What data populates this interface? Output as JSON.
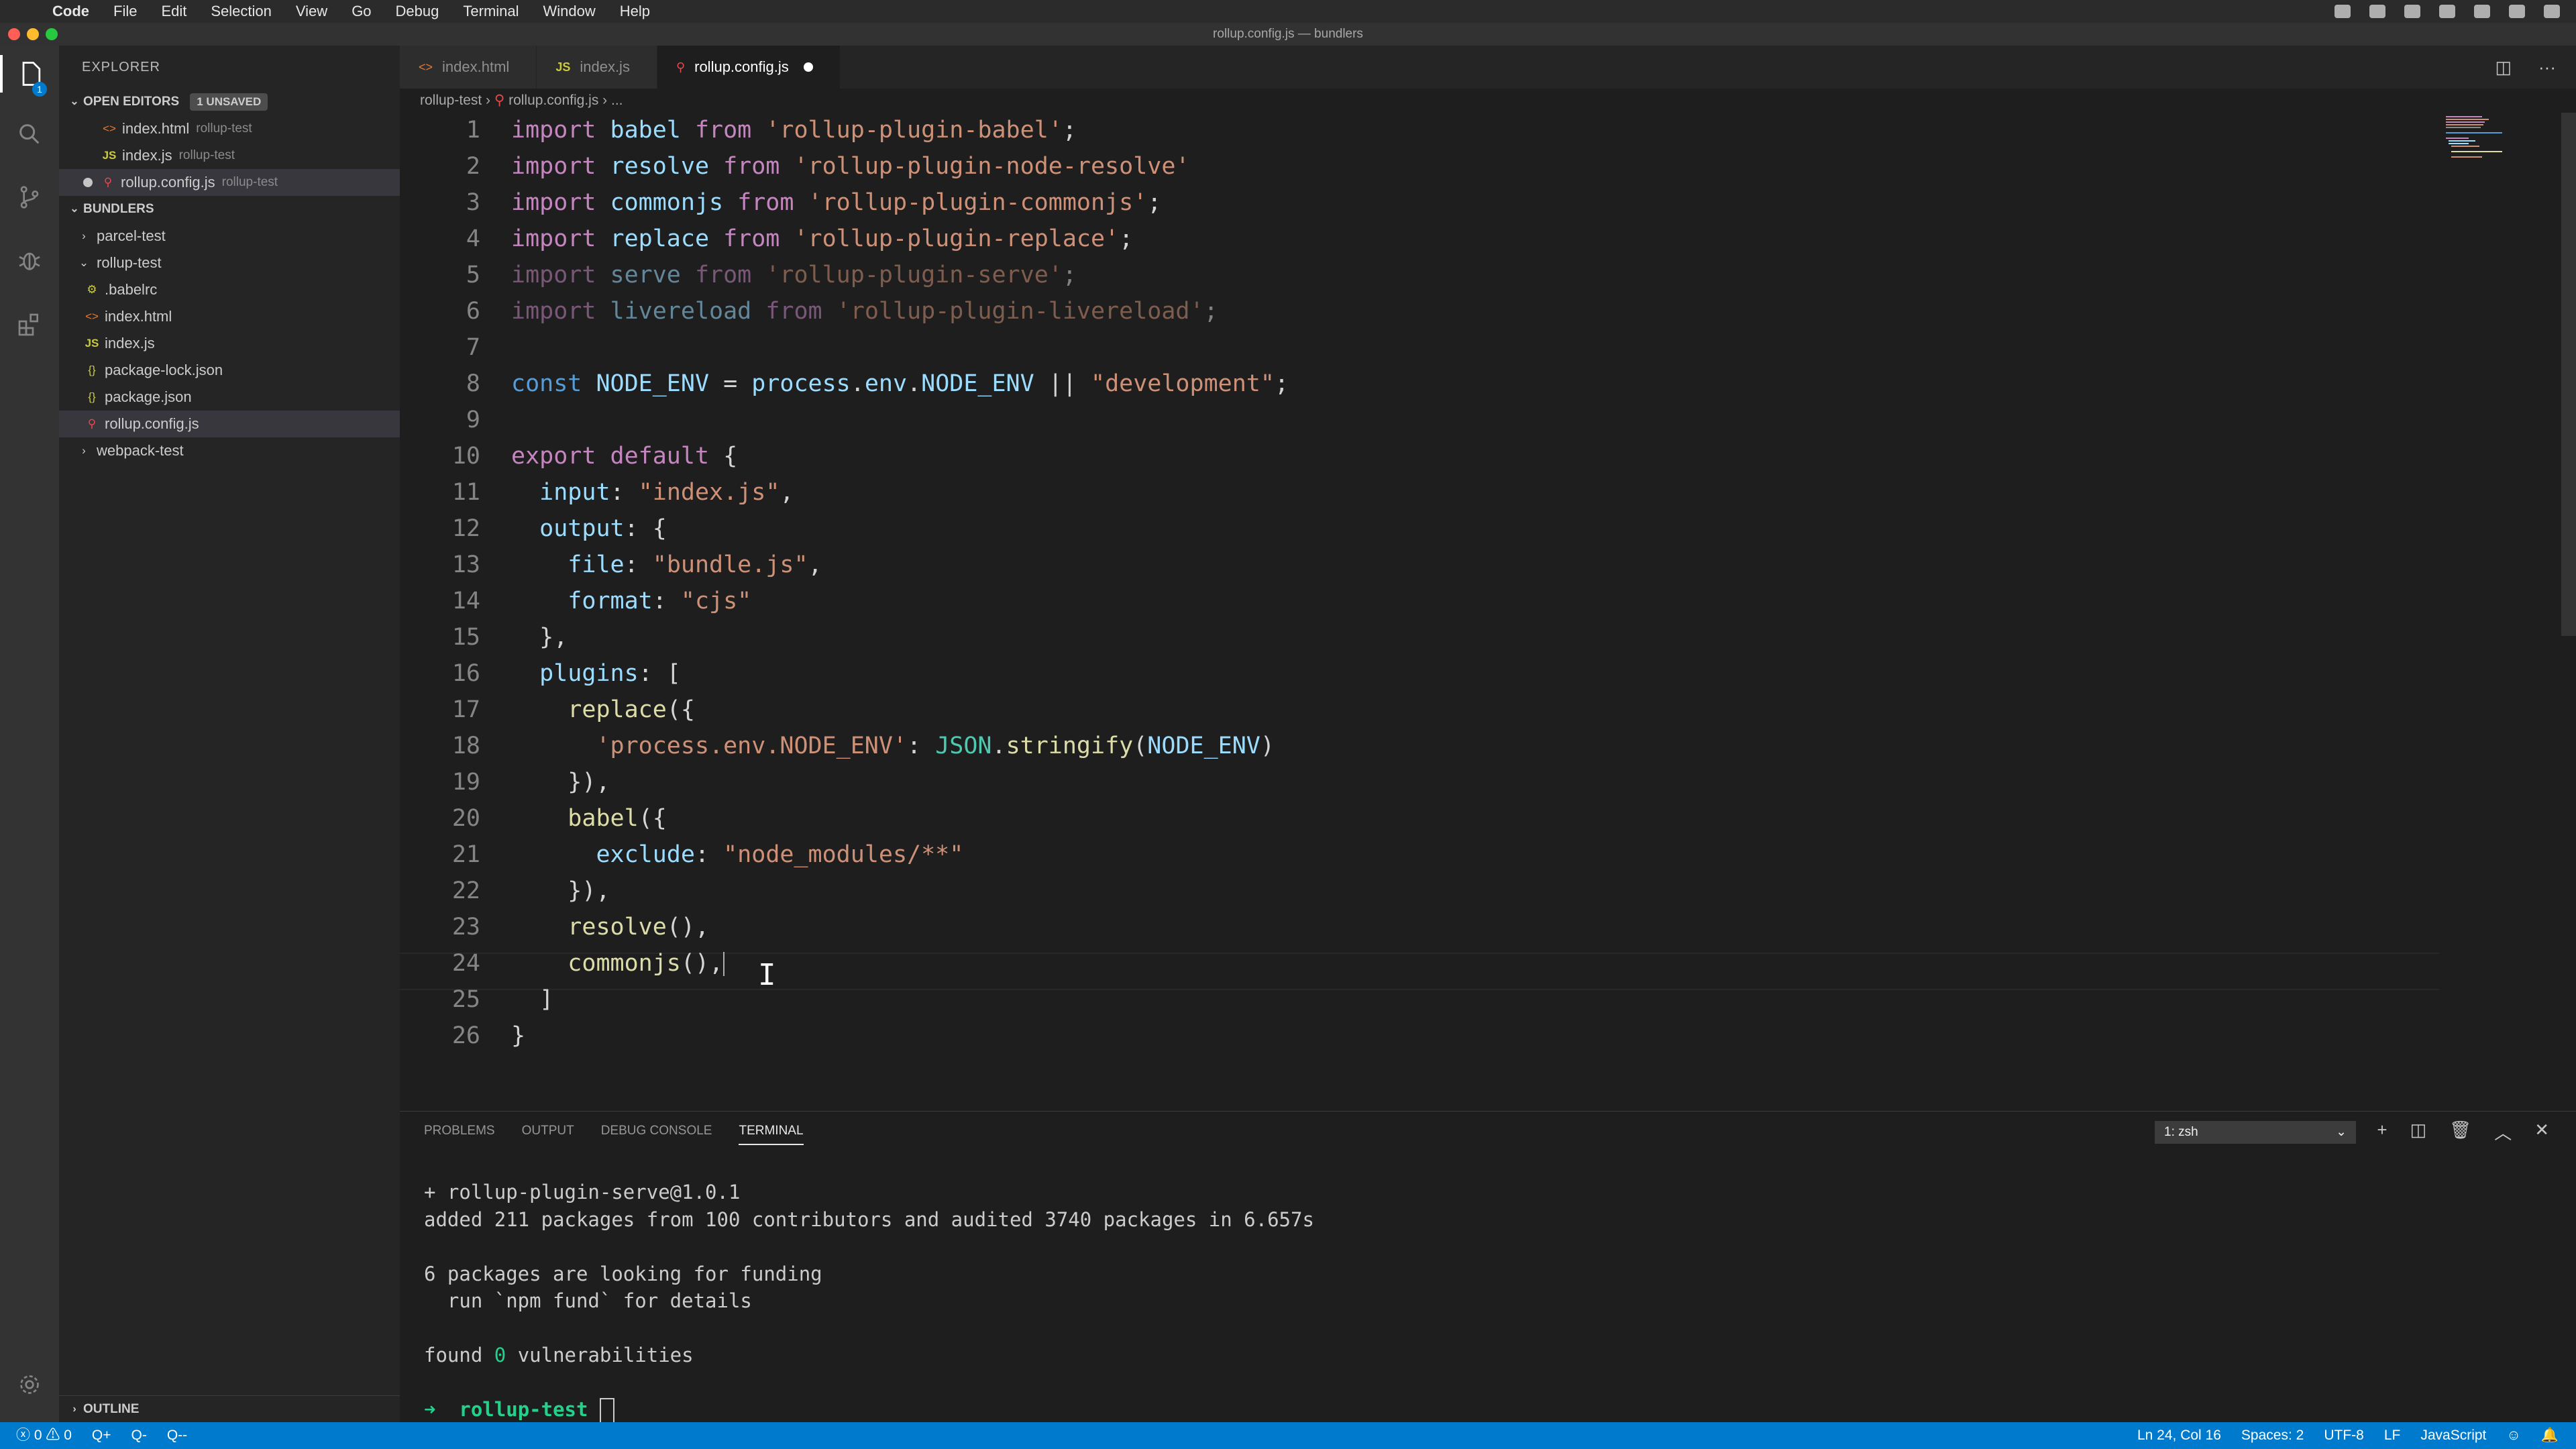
{
  "menubar": {
    "items": [
      "Code",
      "File",
      "Edit",
      "Selection",
      "View",
      "Go",
      "Debug",
      "Terminal",
      "Window",
      "Help"
    ]
  },
  "window": {
    "title": "rollup.config.js — bundlers"
  },
  "activity": {
    "icons": [
      "files-icon",
      "search-icon",
      "source-control-icon",
      "debug-icon",
      "extensions-icon",
      "settings-gear-icon"
    ],
    "badge": "1"
  },
  "sidebar": {
    "title": "EXPLORER",
    "open_editors": {
      "label": "OPEN EDITORS",
      "unsaved": "1 UNSAVED",
      "items": [
        {
          "icon": "<>",
          "name": "index.html",
          "desc": "rollup-test"
        },
        {
          "icon": "JS",
          "name": "index.js",
          "desc": "rollup-test"
        },
        {
          "icon": "⚲",
          "name": "rollup.config.js",
          "desc": "rollup-test"
        }
      ]
    },
    "workspace": {
      "label": "BUNDLERS",
      "items": [
        {
          "icon": "›",
          "name": "parcel-test"
        },
        {
          "icon": "⌄",
          "name": "rollup-test"
        },
        {
          "icon": "⚙",
          "name": ".babelrc"
        },
        {
          "icon": "<>",
          "name": "index.html"
        },
        {
          "icon": "JS",
          "name": "index.js"
        },
        {
          "icon": "{}",
          "name": "package-lock.json"
        },
        {
          "icon": "{}",
          "name": "package.json"
        },
        {
          "icon": "⚲",
          "name": "rollup.config.js"
        },
        {
          "icon": "›",
          "name": "webpack-test"
        }
      ]
    },
    "outline": "OUTLINE"
  },
  "tabs": [
    {
      "icon": "<>",
      "label": "index.html"
    },
    {
      "icon": "JS",
      "label": "index.js"
    },
    {
      "icon": "⚲",
      "label": "rollup.config.js"
    }
  ],
  "breadcrumb": [
    "rollup-test",
    "rollup.config.js",
    "..."
  ],
  "editor": {
    "line_numbers": [
      "1",
      "2",
      "3",
      "4",
      "5",
      "6",
      "7",
      "8",
      "9",
      "10",
      "11",
      "12",
      "13",
      "14",
      "15",
      "16",
      "17",
      "18",
      "19",
      "20",
      "21",
      "22",
      "23",
      "24",
      "25",
      "26"
    ],
    "code": {
      "l1": [
        "import",
        " babel ",
        "from",
        " ",
        "'rollup-plugin-babel'",
        ";"
      ],
      "l2": [
        "import",
        " resolve ",
        "from",
        " ",
        "'rollup-plugin-node-resolve'"
      ],
      "l3": [
        "import",
        " commonjs ",
        "from",
        " ",
        "'rollup-plugin-commonjs'",
        ";"
      ],
      "l4": [
        "import",
        " replace ",
        "from",
        " ",
        "'rollup-plugin-replace'",
        ";"
      ],
      "l5": [
        "import",
        " serve ",
        "from",
        " ",
        "'rollup-plugin-serve'",
        ";"
      ],
      "l6": [
        "import",
        " livereload ",
        "from",
        " ",
        "'rollup-plugin-livereload'",
        ";"
      ],
      "l8": [
        "const",
        " ",
        "NODE_ENV",
        " = ",
        "process",
        ".",
        "env",
        ".",
        "NODE_ENV",
        " || ",
        "\"development\"",
        ";"
      ],
      "l10": [
        "export",
        " ",
        "default",
        " {"
      ],
      "l11": [
        "  ",
        "input",
        ": ",
        "\"index.js\"",
        ","
      ],
      "l12": [
        "  ",
        "output",
        ": {"
      ],
      "l13": [
        "    ",
        "file",
        ": ",
        "\"bundle.js\"",
        ","
      ],
      "l14": [
        "    ",
        "format",
        ": ",
        "\"cjs\""
      ],
      "l15": [
        "  },"
      ],
      "l16": [
        "  ",
        "plugins",
        ": ["
      ],
      "l17": [
        "    ",
        "replace",
        "({"
      ],
      "l18": [
        "      ",
        "'process.env.NODE_ENV'",
        ": ",
        "JSON",
        ".",
        "stringify",
        "(",
        "NODE_ENV",
        ")"
      ],
      "l19": [
        "    }),"
      ],
      "l20": [
        "    ",
        "babel",
        "({"
      ],
      "l21": [
        "      ",
        "exclude",
        ": ",
        "\"node_modules/**\""
      ],
      "l22": [
        "    }),"
      ],
      "l23": [
        "    ",
        "resolve",
        "(),"
      ],
      "l24": [
        "    ",
        "commonjs",
        "(),"
      ],
      "l25": [
        "  ]"
      ],
      "l26": [
        "}"
      ]
    }
  },
  "panel": {
    "tabs": [
      "PROBLEMS",
      "OUTPUT",
      "DEBUG CONSOLE",
      "TERMINAL"
    ],
    "terminal_select": "1: zsh",
    "terminal": {
      "line1": "+ rollup-plugin-serve@1.0.1",
      "line2": "added 211 packages from 100 contributors and audited 3740 packages in 6.657s",
      "line3": "6 packages are looking for funding",
      "line4": "  run `npm fund` for details",
      "line5_pre": "found ",
      "line5_num": "0",
      "line5_post": " vulnerabilities",
      "prompt_arrow": "➜",
      "prompt_dir": "rollup-test"
    }
  },
  "status": {
    "errors": "0",
    "warnings": "0",
    "items_left": [
      "Q+",
      "Q-",
      "Q--"
    ],
    "position": "Ln 24, Col 16",
    "spaces": "Spaces: 2",
    "encoding": "UTF-8",
    "eol": "LF",
    "language": "JavaScript"
  },
  "colors": {
    "accent": "#007acc",
    "keyword": "#c586c0",
    "string": "#ce9178",
    "variable": "#9cdcfe"
  }
}
